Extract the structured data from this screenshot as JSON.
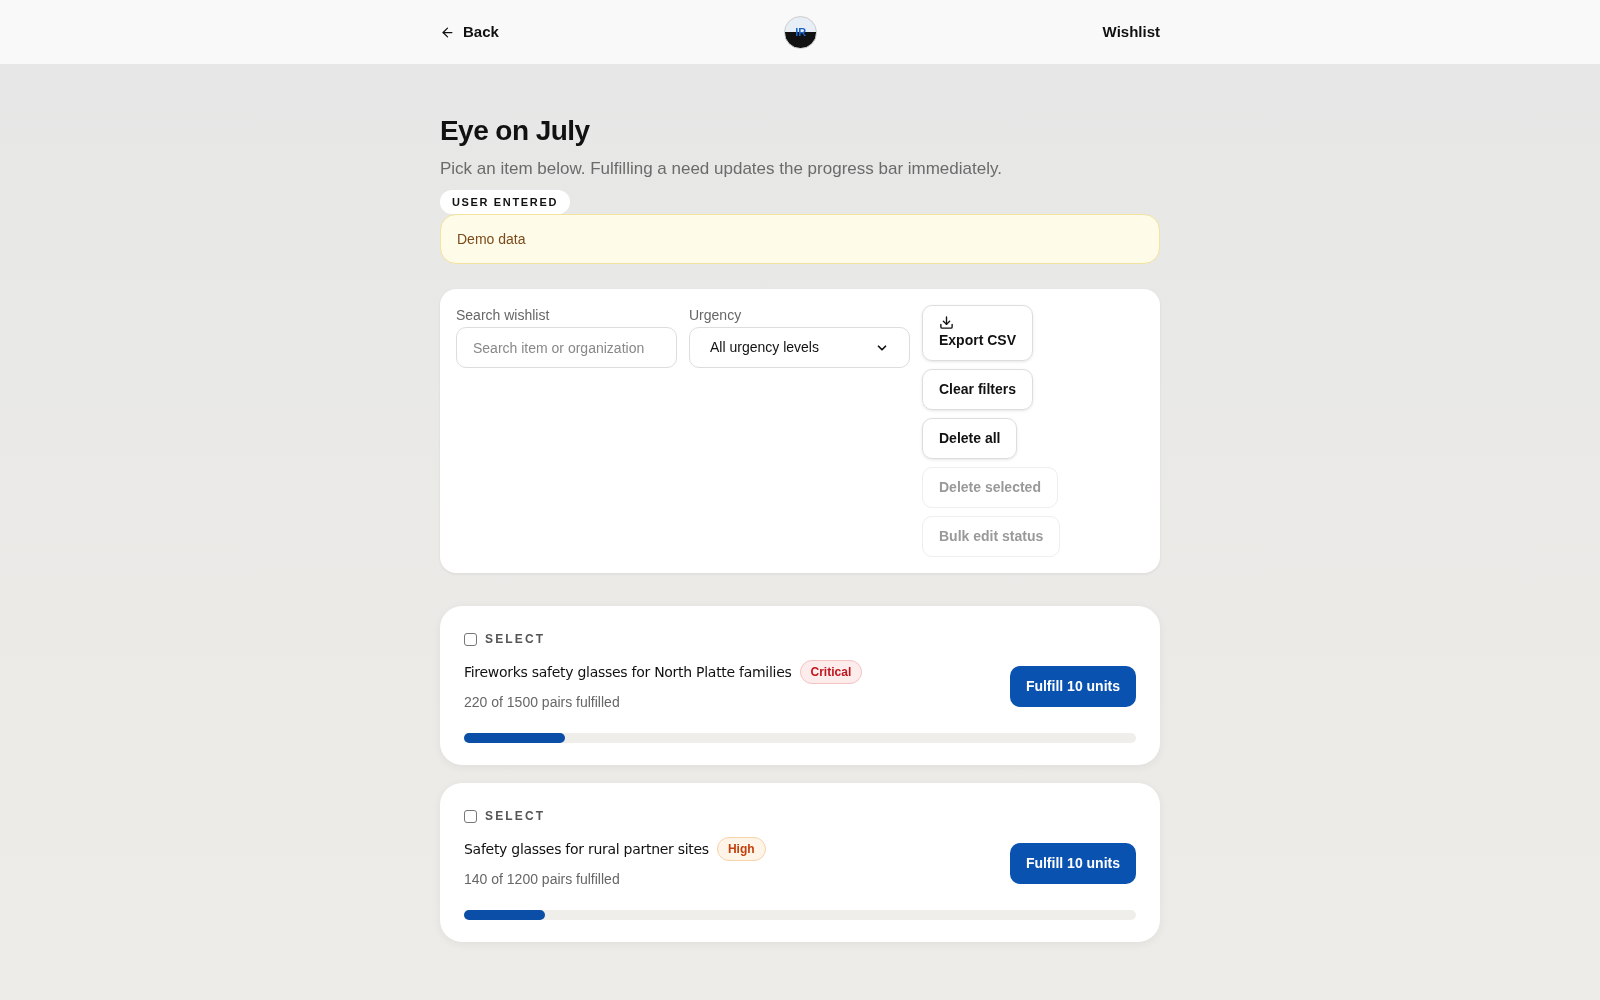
{
  "header": {
    "back": "Back",
    "logo_text": "IR",
    "link": "Wishlist"
  },
  "title": "Eye on July",
  "subtitle": "Pick an item below. Fulfilling a need updates the progress bar immediately.",
  "source_badge": "USER ENTERED",
  "notice": "Demo data",
  "filters": {
    "search_label": "Search wishlist",
    "search_placeholder": "Search item or organization",
    "urgency_label": "Urgency",
    "urgency_value": "All urgency levels",
    "buttons": [
      {
        "label": "Export CSV",
        "kind": "download",
        "disabled": false
      },
      {
        "label": "Clear filters",
        "disabled": false
      },
      {
        "label": "Delete all",
        "disabled": false
      },
      {
        "label": "Delete selected",
        "disabled": true
      },
      {
        "label": "Bulk edit status",
        "disabled": true
      }
    ]
  },
  "items": [
    {
      "select_label": "SELECT",
      "checked": false,
      "name": "Fireworks safety glasses for North Platte families",
      "urgency": "Critical",
      "kind": "critical",
      "progress": "220 of 1500 pairs fulfilled",
      "level": 0.15,
      "action": "Fulfill 10 units"
    },
    {
      "select_label": "SELECT",
      "checked": false,
      "name": "Safety glasses for rural partner sites",
      "urgency": "High",
      "kind": "high",
      "progress": "140 of 1200 pairs fulfilled",
      "level": 0.12,
      "action": "Fulfill 10 units"
    }
  ]
}
